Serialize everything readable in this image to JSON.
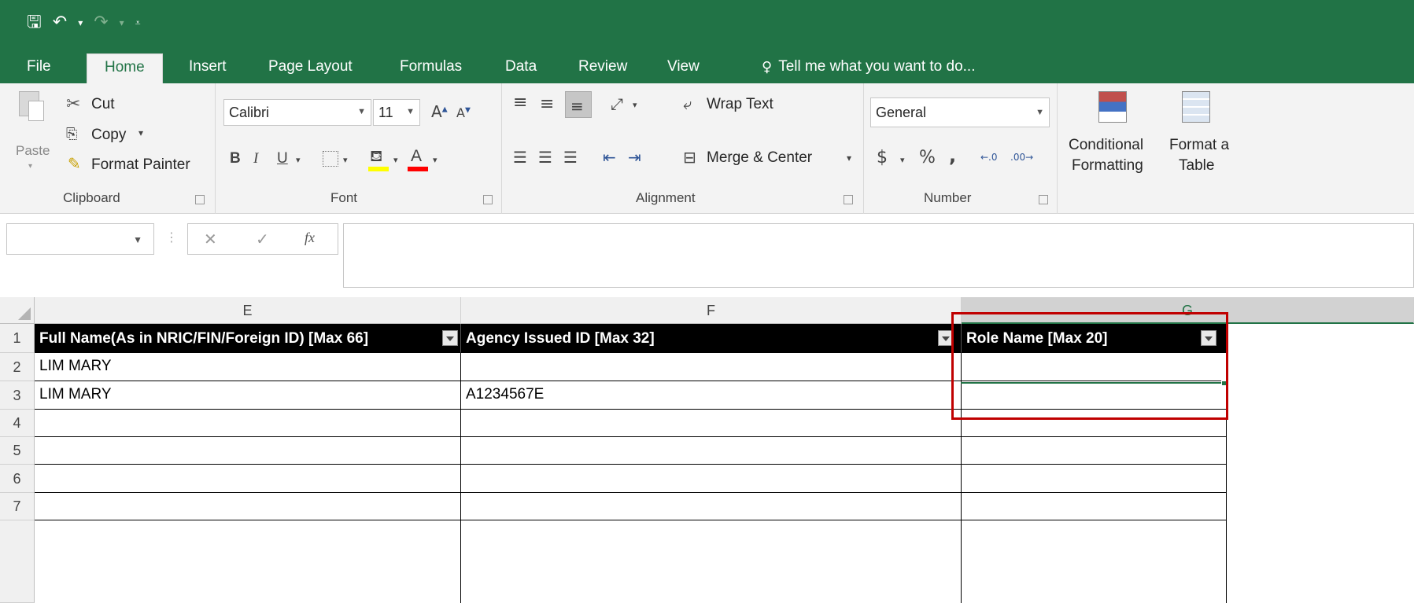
{
  "qat": {
    "save_icon": "save-icon",
    "undo_icon": "undo-icon",
    "redo_icon": "redo-icon",
    "customize_icon": "customize-qat-icon"
  },
  "tabs": {
    "file": "File",
    "home": "Home",
    "insert": "Insert",
    "page_layout": "Page Layout",
    "formulas": "Formulas",
    "data": "Data",
    "review": "Review",
    "view": "View",
    "tell_me": "Tell me what you want to do..."
  },
  "clipboard": {
    "paste": "Paste",
    "cut": "Cut",
    "copy": "Copy",
    "format_painter": "Format Painter",
    "label": "Clipboard"
  },
  "font": {
    "family": "Calibri",
    "size": "11",
    "bold": "B",
    "italic": "I",
    "underline": "U",
    "label": "Font"
  },
  "alignment": {
    "wrap_text": "Wrap Text",
    "merge_center": "Merge & Center",
    "label": "Alignment"
  },
  "number": {
    "format": "General",
    "currency": "$",
    "percent": "%",
    "comma": ",",
    "label": "Number"
  },
  "styles": {
    "conditional_line1": "Conditional",
    "conditional_line2": "Formatting",
    "format_table_line1": "Format a",
    "format_table_line2": "Table"
  },
  "formula_bar": {
    "name_box": "",
    "cancel": "✕",
    "enter": "✓",
    "fx": "fx",
    "formula": ""
  },
  "columns": [
    "E",
    "F",
    "G"
  ],
  "rows": [
    "1",
    "2",
    "3",
    "4",
    "5",
    "6",
    "7"
  ],
  "table": {
    "headers": [
      "Full Name(As in NRIC/FIN/Foreign ID) [Max 66]",
      "Agency Issued ID [Max 32]",
      "Role Name [Max 20]"
    ],
    "data": [
      [
        "LIM MARY",
        "",
        ""
      ],
      [
        "LIM MARY",
        "A1234567E",
        ""
      ],
      [
        "",
        "",
        ""
      ],
      [
        "",
        "",
        ""
      ],
      [
        "",
        "",
        ""
      ],
      [
        "",
        "",
        ""
      ]
    ]
  },
  "colors": {
    "excel_green": "#217346",
    "highlight_red": "#c00000"
  }
}
